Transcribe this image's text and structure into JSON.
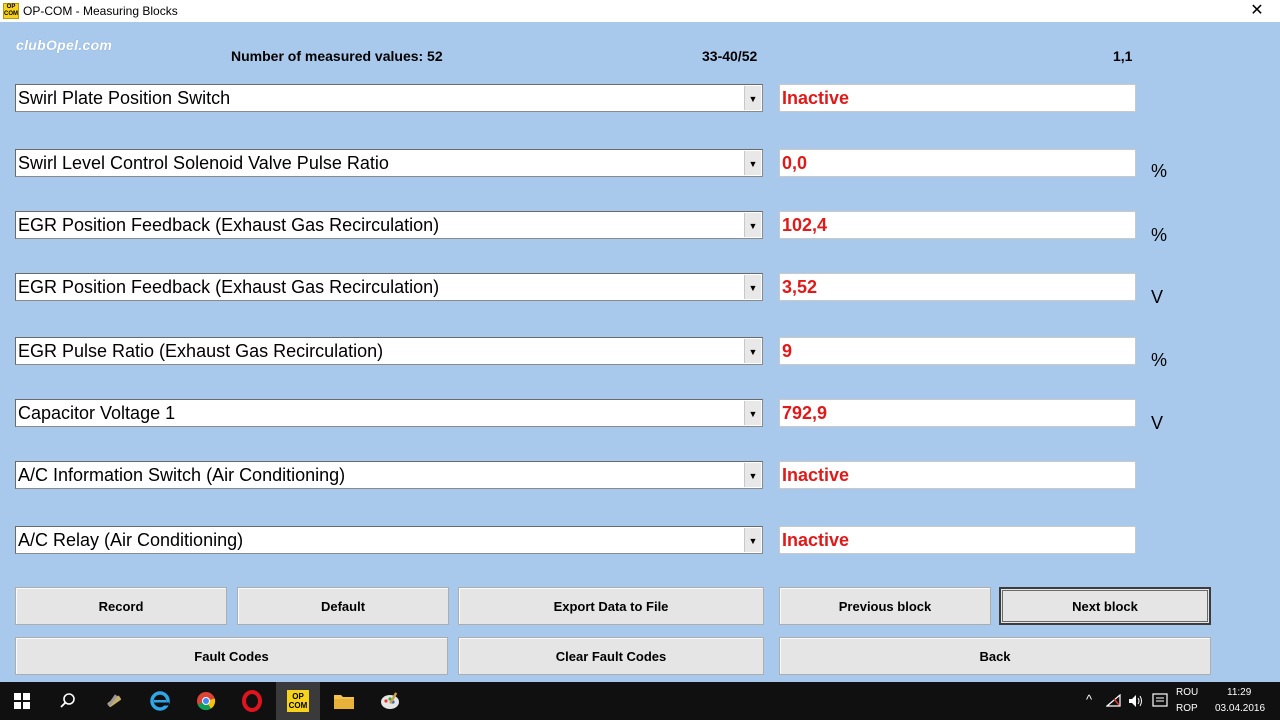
{
  "window": {
    "app_icon_text": "OP COM",
    "title": "OP-COM - Measuring Blocks",
    "close_glyph": "✕"
  },
  "watermark": "clubOpel.com",
  "header": {
    "count_label": "Number of measured values: 52",
    "range": "33-40/52",
    "page": "1,1"
  },
  "rows": [
    {
      "name": "Swirl Plate Position Switch",
      "value": "Inactive",
      "unit": ""
    },
    {
      "name": "Swirl Level Control Solenoid Valve Pulse Ratio",
      "value": "0,0",
      "unit": "%"
    },
    {
      "name": "EGR Position Feedback (Exhaust Gas Recirculation)",
      "value": "102,4",
      "unit": "%"
    },
    {
      "name": "EGR Position Feedback (Exhaust Gas Recirculation)",
      "value": "3,52",
      "unit": "V"
    },
    {
      "name": "EGR Pulse Ratio (Exhaust Gas Recirculation)",
      "value": "9",
      "unit": "%"
    },
    {
      "name": "Capacitor Voltage 1",
      "value": "792,9",
      "unit": "V"
    },
    {
      "name": "A/C Information Switch (Air Conditioning)",
      "value": "Inactive",
      "unit": ""
    },
    {
      "name": "A/C Relay (Air Conditioning)",
      "value": "Inactive",
      "unit": ""
    }
  ],
  "dropdown_arrow": "▼",
  "buttons": {
    "record": "Record",
    "default": "Default",
    "export": "Export Data to File",
    "previous_block": "Previous block",
    "next_block": "Next block",
    "fault_codes": "Fault Codes",
    "clear_fault_codes": "Clear Fault Codes",
    "back": "Back"
  },
  "taskbar": {
    "opcom_icon_text": "OP COM",
    "tray_chevron": "^",
    "language_top": "ROU",
    "language_bottom": "ROP",
    "time": "11:29",
    "date": "03.04.2016"
  },
  "colors": {
    "background": "#a9c9ec",
    "value_text": "#e01a1a",
    "taskbar": "#101010"
  }
}
